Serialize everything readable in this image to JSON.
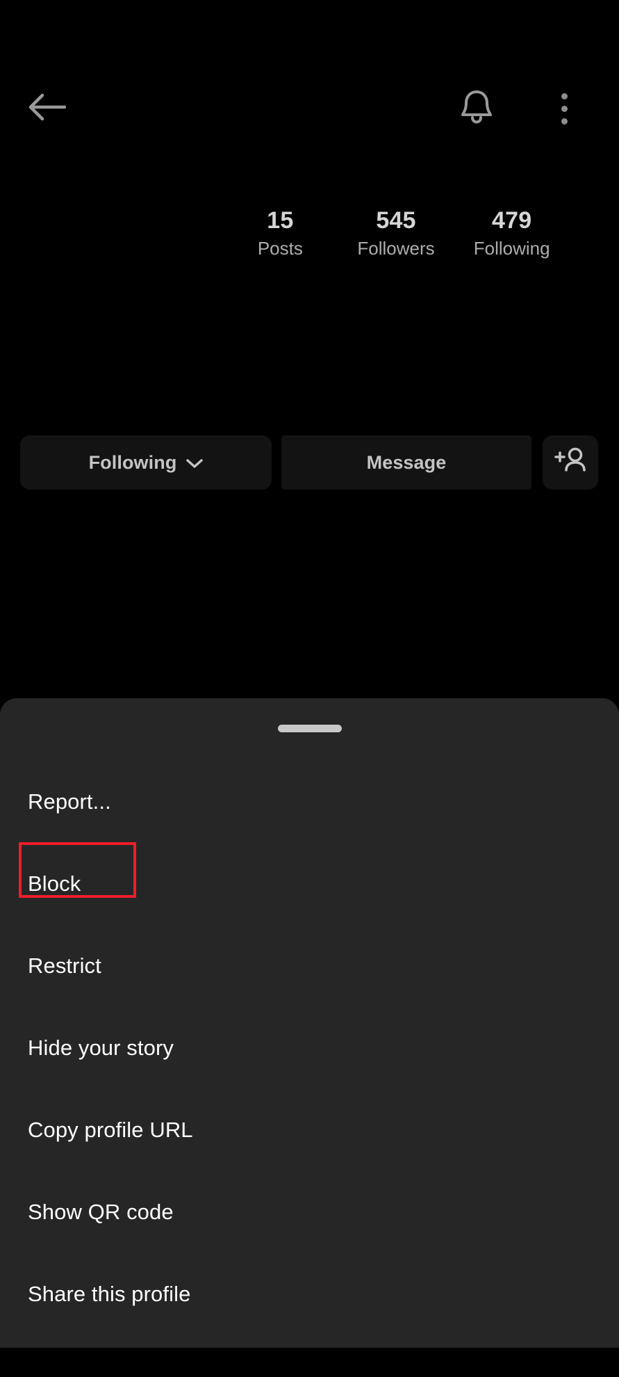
{
  "app": {
    "theme_background": "#000000",
    "sheet_background": "#262626",
    "button_background": "#131313",
    "highlight_color": "#ee1d2b",
    "text_primary": "#ffffff",
    "text_secondary": "#adadad"
  },
  "topbar": {
    "back_icon": "back-arrow-icon",
    "notifications_icon": "bell-icon",
    "more_icon": "kebab-menu-icon"
  },
  "profile": {
    "stats": [
      {
        "value": "15",
        "label": "Posts"
      },
      {
        "value": "545",
        "label": "Followers"
      },
      {
        "value": "479",
        "label": "Following"
      }
    ]
  },
  "actions": {
    "following_label": "Following",
    "following_chevron": "chevron-down-icon",
    "message_label": "Message",
    "add_user_icon": "add-person-icon"
  },
  "sheet": {
    "handle": "drag-handle",
    "items": [
      {
        "label": "Report...",
        "name": "report",
        "highlighted": false
      },
      {
        "label": "Block",
        "name": "block",
        "highlighted": true
      },
      {
        "label": "Restrict",
        "name": "restrict",
        "highlighted": false
      },
      {
        "label": "Hide your story",
        "name": "hide-your-story",
        "highlighted": false
      },
      {
        "label": "Copy profile URL",
        "name": "copy-profile-url",
        "highlighted": false
      },
      {
        "label": "Show QR code",
        "name": "show-qr-code",
        "highlighted": false
      },
      {
        "label": "Share this profile",
        "name": "share-this-profile",
        "highlighted": false
      }
    ]
  }
}
